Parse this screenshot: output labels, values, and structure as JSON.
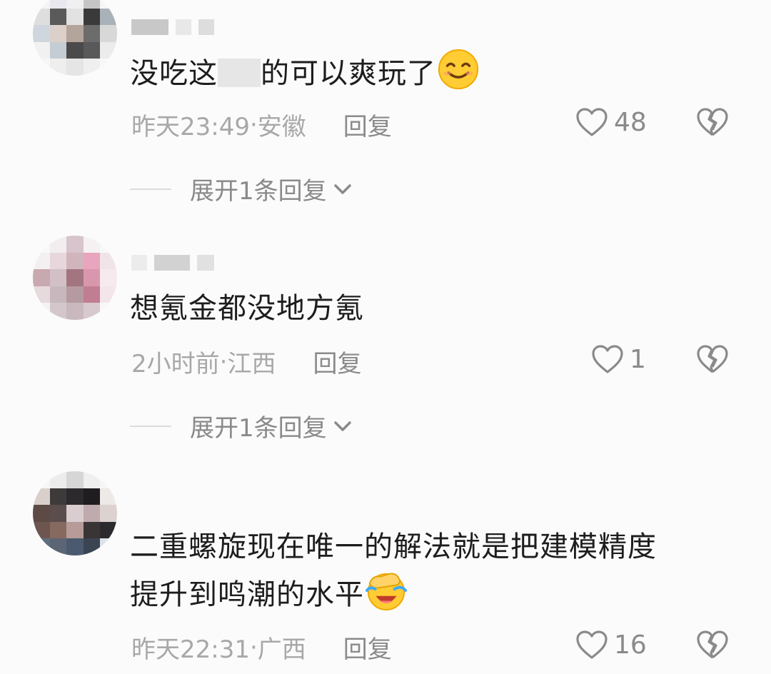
{
  "comments": [
    {
      "text_before": "没吃这",
      "text_after": "的可以爽玩了",
      "emoji": "smiling-face",
      "time": "昨天23:49",
      "location": "安徽",
      "reply_label": "回复",
      "likes": "48",
      "expand_label": "展开1条回复"
    },
    {
      "text": "想氪金都没地方氪",
      "time": "2小时前",
      "location": "江西",
      "reply_label": "回复",
      "likes": "1",
      "expand_label": "展开1条回复"
    },
    {
      "text_line1": "二重螺旋现在唯一的解法就是把建模精度",
      "text_line2": "提升到鸣潮的水平",
      "emoji": "facepalm-laughing",
      "time": "昨天22:31",
      "location": "广西",
      "reply_label": "回复",
      "likes": "16"
    }
  ],
  "separator": " · ",
  "colors": {
    "background": "#fbfbfb",
    "text": "#1d1d1d",
    "meta": "#a8a8a8",
    "action": "#8a8a8a"
  }
}
